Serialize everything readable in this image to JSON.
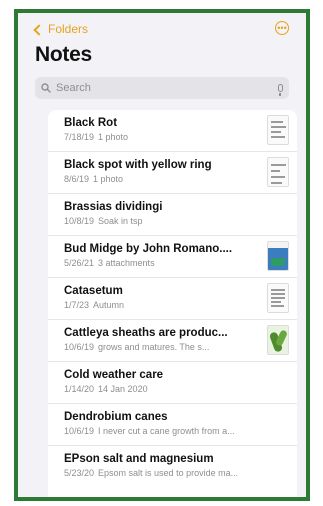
{
  "nav": {
    "back_label": "Folders",
    "more_icon": "ellipsis-circle-icon"
  },
  "page": {
    "title": "Notes"
  },
  "search": {
    "placeholder": "Search"
  },
  "colors": {
    "accent": "#e8a31b",
    "frame": "#2d7a34"
  },
  "notes": [
    {
      "title": "Black Rot",
      "date": "7/18/19",
      "preview": "1 photo",
      "thumbnail": "document"
    },
    {
      "title": "Black spot with yellow ring",
      "date": "8/6/19",
      "preview": "1 photo",
      "thumbnail": "document"
    },
    {
      "title": "Brassias dividingi",
      "date": "10/8/19",
      "preview": "Soak in tsp",
      "thumbnail": "none"
    },
    {
      "title": "Bud Midge by John Romano....",
      "date": "5/26/21",
      "preview": "3 attachments",
      "thumbnail": "photo"
    },
    {
      "title": "Catasetum",
      "date": "1/7/23",
      "preview": "Autumn",
      "thumbnail": "document"
    },
    {
      "title": "Cattleya sheaths are produc...",
      "date": "10/6/19",
      "preview": "grows and matures. The s...",
      "thumbnail": "photo"
    },
    {
      "title": "Cold weather care",
      "date": "1/14/20",
      "preview": "14 Jan 2020",
      "thumbnail": "none"
    },
    {
      "title": "Dendrobium canes",
      "date": "10/6/19",
      "preview": "I never cut a cane growth from a...",
      "thumbnail": "none"
    },
    {
      "title": "EPson salt and magnesium",
      "date": "5/23/20",
      "preview": "Epsom salt is used to provide ma...",
      "thumbnail": "none"
    }
  ]
}
